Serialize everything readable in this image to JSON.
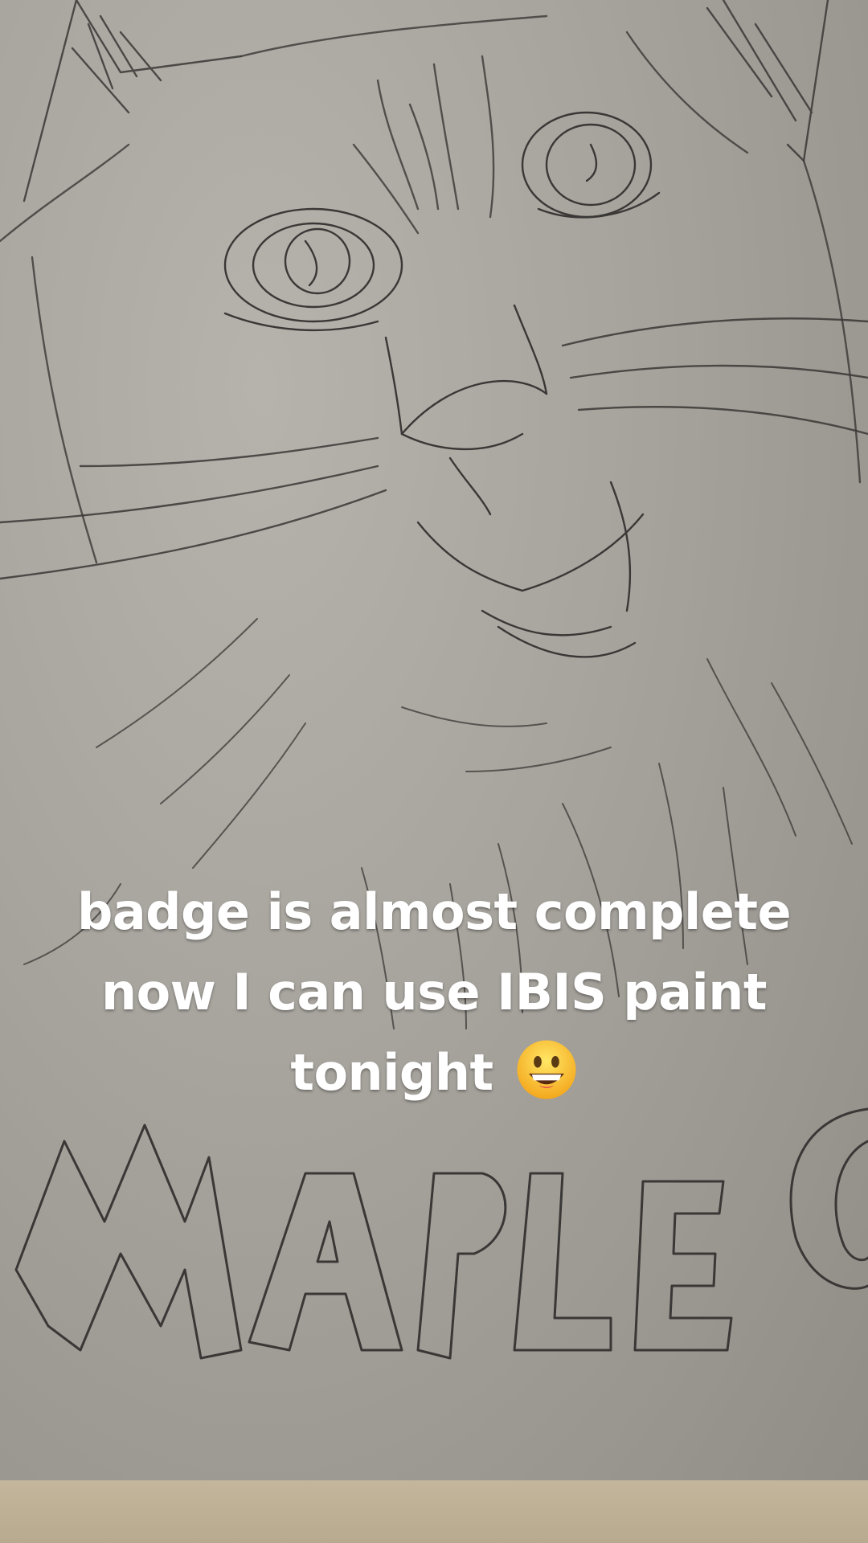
{
  "caption": {
    "line1": "badge is almost complete",
    "line2": "now I can use IBIS paint",
    "line3": "tonight",
    "emoji": "grinning-face-emoji"
  },
  "drawing": {
    "subject": "pencil-sketch-cat-head",
    "lettering": "MAPLE"
  },
  "colors": {
    "paper": "#a8a49e",
    "pencil": "#3a3836",
    "caption_text": "#ffffff",
    "floor": "#c3b69c"
  }
}
